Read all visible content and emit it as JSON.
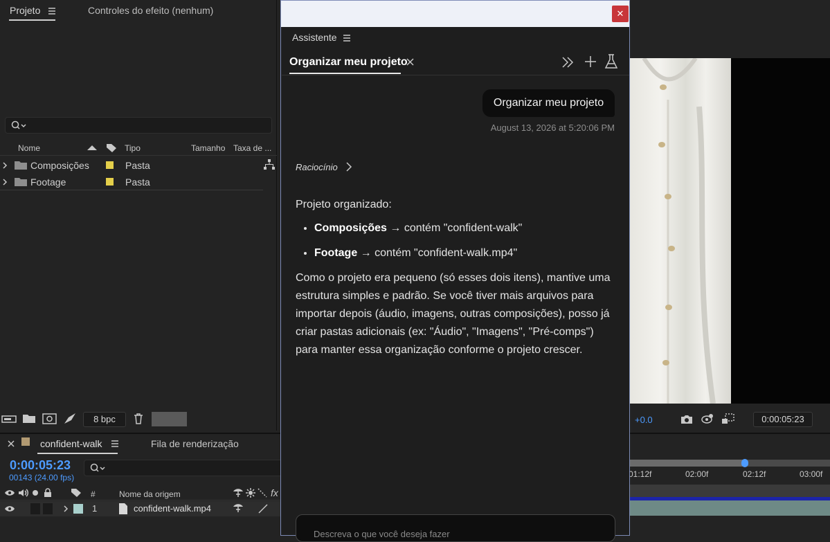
{
  "project_panel": {
    "tab_project": "Projeto",
    "tab_effect_controls": "Controles do efeito (nenhum)",
    "columns": {
      "name": "Nome",
      "type": "Tipo",
      "size": "Tamanho",
      "rate": "Taxa de ..."
    },
    "items": [
      {
        "name": "Composições",
        "type": "Pasta",
        "label_color": "#e4cf4a"
      },
      {
        "name": "Footage",
        "type": "Pasta",
        "label_color": "#e4cf4a"
      }
    ],
    "bit_depth": "8 bpc"
  },
  "viewer": {
    "exposure": "+0.0",
    "timecode": "0:00:05:23"
  },
  "timeline": {
    "comp_tab": "confident-walk",
    "render_queue_tab": "Fila de renderização",
    "current_time": "0:00:05:23",
    "frame_info": "00143 (24.00 fps)",
    "layer_header": {
      "num": "#",
      "source_name": "Nome da origem",
      "fx": "fx"
    },
    "layers": [
      {
        "index": "1",
        "name": "confident-walk.mp4"
      }
    ],
    "ruler_labels": [
      "01:12f",
      "02:00f",
      "02:12f",
      "03:00f"
    ]
  },
  "assistant": {
    "panel_title": "Assistente",
    "tab_label": "Organizar meu projeto",
    "user_message": "Organizar meu projeto",
    "user_message_time": "August 13, 2026 at 5:20:06 PM",
    "reasoning_label": "Raciocínio",
    "response_intro": "Projeto organizado:",
    "bullets": [
      {
        "bold": "Composições",
        "text": " → contém \"confident-walk\""
      },
      {
        "bold": "Footage",
        "text": " → contém \"confident-walk.mp4\""
      }
    ],
    "response_paragraph": "Como o projeto era pequeno (só esses dois itens), mantive uma estrutura simples e padrão. Se você tiver mais arquivos para importar depois (áudio, imagens, outras composições), posso já criar pastas adicionais (ex: \"Áudio\", \"Imagens\", \"Pré-comps\") para manter essa organização conforme o projeto crescer.",
    "input_placeholder": "Descreva o que você deseja fazer"
  },
  "colors": {
    "accent_blue": "#4d9bff",
    "close_red": "#c8363a",
    "folder_label_yellow": "#e4cf4a"
  }
}
